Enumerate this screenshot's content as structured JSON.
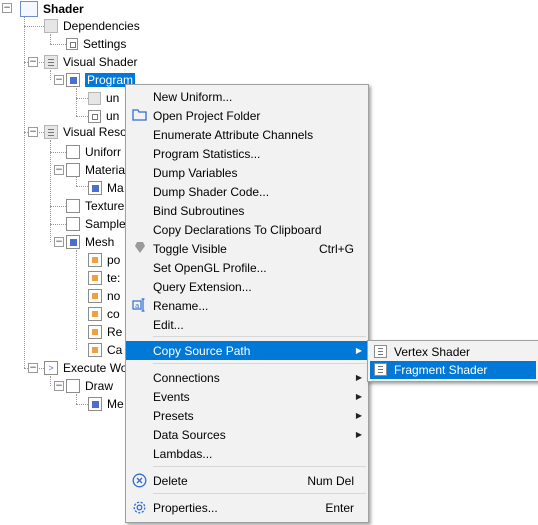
{
  "tree": {
    "root": "Shader",
    "items": {
      "dependencies": "Dependencies",
      "settings": "Settings",
      "visual_shader": "Visual Shader",
      "program": "Program",
      "un1": "un",
      "un2": "un",
      "visual_resources": "Visual Reso",
      "uniform": "Uniforr",
      "material": "Materia",
      "ma": "Ma",
      "texture": "Texture",
      "sampler": "Sample",
      "mesh": "Mesh",
      "po": "po",
      "te": "te:",
      "no": "no",
      "co": "co",
      "re": "Re",
      "ca": "Ca",
      "execute": "Execute Wo",
      "draw": "Draw",
      "me": "Me"
    }
  },
  "context_menu": {
    "items": [
      {
        "label": "New Uniform...",
        "icon": ""
      },
      {
        "label": "Open Project Folder",
        "icon": "folder-icon"
      },
      {
        "label": "Enumerate Attribute Channels",
        "icon": ""
      },
      {
        "label": "Program Statistics...",
        "icon": ""
      },
      {
        "label": "Dump Variables",
        "icon": ""
      },
      {
        "label": "Dump Shader Code...",
        "icon": ""
      },
      {
        "label": "Bind Subroutines",
        "icon": ""
      },
      {
        "label": "Copy Declarations To Clipboard",
        "icon": ""
      },
      {
        "label": "Toggle Visible",
        "shortcut": "Ctrl+G",
        "icon": "toggle-icon"
      },
      {
        "label": "Set OpenGL Profile...",
        "icon": ""
      },
      {
        "label": "Query Extension...",
        "icon": ""
      },
      {
        "label": "Rename...",
        "icon": "rename-icon"
      },
      {
        "label": "Edit...",
        "icon": ""
      },
      {
        "label": "Copy Source Path",
        "submenu": true
      },
      {
        "label": "Connections",
        "submenu": true
      },
      {
        "label": "Events",
        "submenu": true
      },
      {
        "label": "Presets",
        "submenu": true
      },
      {
        "label": "Data Sources",
        "submenu": true
      },
      {
        "label": "Lambdas...",
        "icon": ""
      },
      {
        "label": "Delete",
        "shortcut": "Num Del",
        "icon": "delete-icon"
      },
      {
        "label": "Properties...",
        "shortcut": "Enter",
        "icon": "gear-icon"
      }
    ]
  },
  "submenu": {
    "items": [
      {
        "label": "Vertex Shader"
      },
      {
        "label": "Fragment Shader"
      }
    ]
  },
  "colors": {
    "accent": "#0078d7",
    "menu_bg": "#f2f2f2"
  }
}
